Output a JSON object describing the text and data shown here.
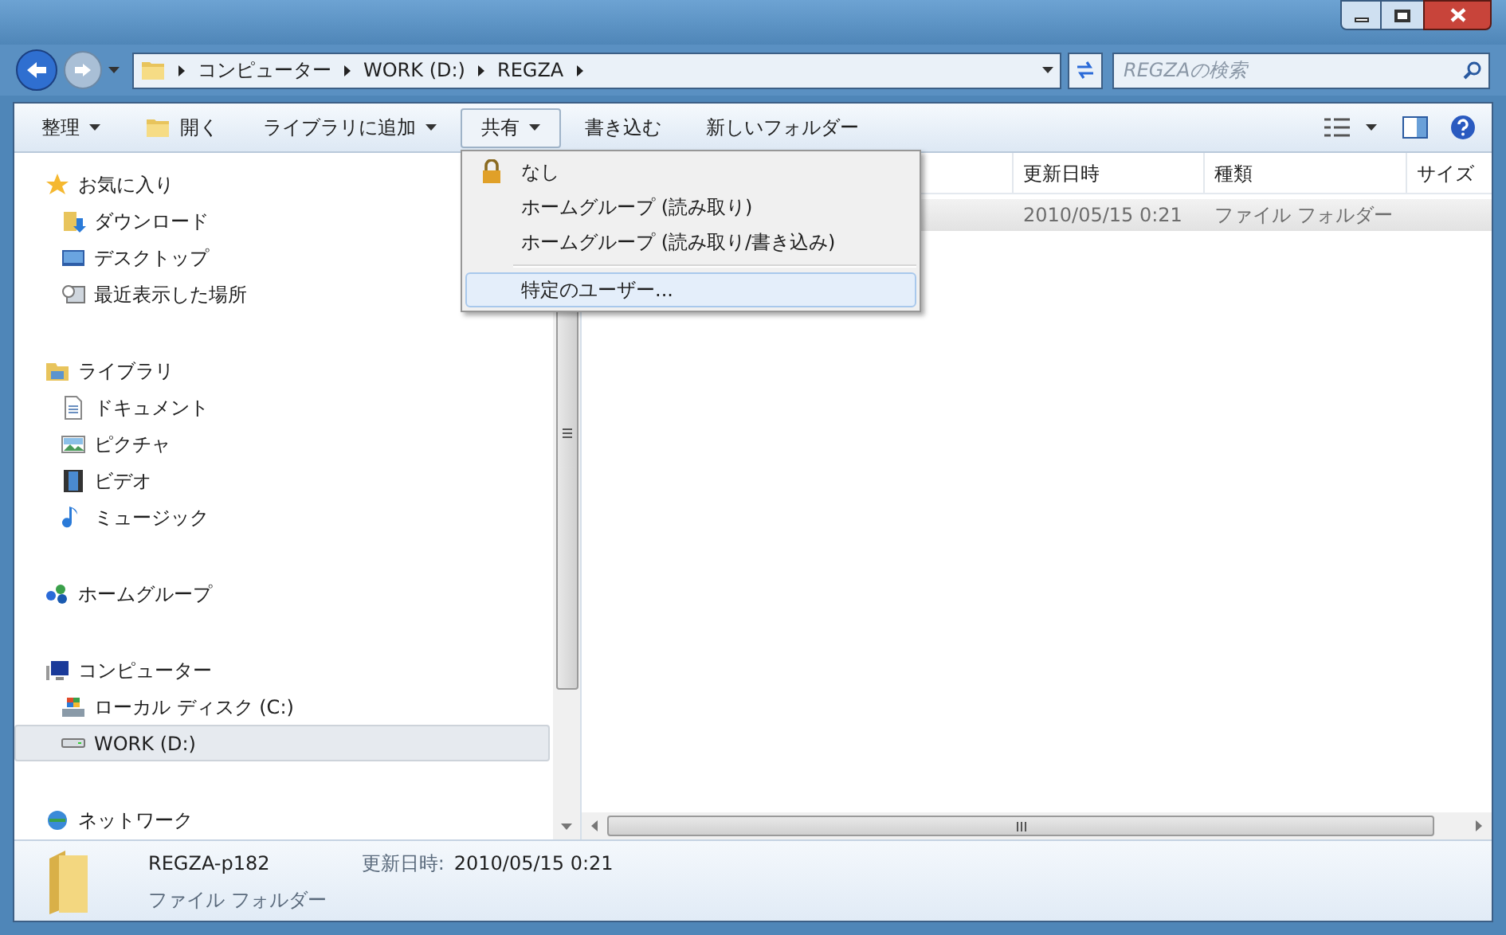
{
  "address_bar": {
    "crumbs": [
      "コンピューター",
      "WORK (D:)",
      "REGZA"
    ]
  },
  "search": {
    "placeholder": "REGZAの検索"
  },
  "toolbar": {
    "items": [
      {
        "label": "整理",
        "kind": "menu",
        "open": false
      },
      {
        "label": "開く",
        "kind": "iconed",
        "open": false
      },
      {
        "label": "ライブラリに追加",
        "kind": "menu",
        "open": false
      },
      {
        "label": "共有",
        "kind": "menu",
        "open": true
      },
      {
        "label": "書き込む",
        "kind": "plain",
        "open": false
      },
      {
        "label": "新しいフォルダー",
        "kind": "plain",
        "open": false
      }
    ]
  },
  "share_menu": {
    "items": [
      {
        "label": "なし",
        "kind": "locked",
        "selected": false
      },
      {
        "label": "ホームグループ (読み取り)",
        "kind": "plain",
        "selected": false
      },
      {
        "label": "ホームグループ (読み取り/書き込み)",
        "kind": "plain",
        "selected": false
      },
      {
        "label": "特定のユーザー...",
        "kind": "separated",
        "selected": true
      }
    ]
  },
  "navigation": {
    "groups": [
      {
        "label": "お気に入り",
        "selected": false,
        "children": [
          {
            "label": "ダウンロード",
            "selected": false
          },
          {
            "label": "デスクトップ",
            "selected": false
          },
          {
            "label": "最近表示した場所",
            "selected": false
          }
        ]
      },
      {
        "label": "ライブラリ",
        "selected": false,
        "children": [
          {
            "label": "ドキュメント",
            "selected": false
          },
          {
            "label": "ピクチャ",
            "selected": false
          },
          {
            "label": "ビデオ",
            "selected": false
          },
          {
            "label": "ミュージック",
            "selected": false
          }
        ]
      },
      {
        "label": "ホームグループ",
        "selected": false
      },
      {
        "label": "コンピューター",
        "selected": false,
        "children": [
          {
            "label": "ローカル ディスク (C:)",
            "selected": false
          },
          {
            "label": "WORK (D:)",
            "selected": true
          }
        ]
      },
      {
        "label": "ネットワーク",
        "selected": false
      }
    ]
  },
  "file_list": {
    "columns": [
      "更新日時",
      "種類",
      "サイズ"
    ],
    "rows": [
      {
        "cells": [
          "2010/05/15 0:21",
          "ファイル フォルダー"
        ],
        "selected": true
      }
    ]
  },
  "details_pane": {
    "name": "REGZA-p182",
    "meta_label": "更新日時:",
    "meta_value": "2010/05/15 0:21",
    "type": "ファイル フォルダー"
  }
}
